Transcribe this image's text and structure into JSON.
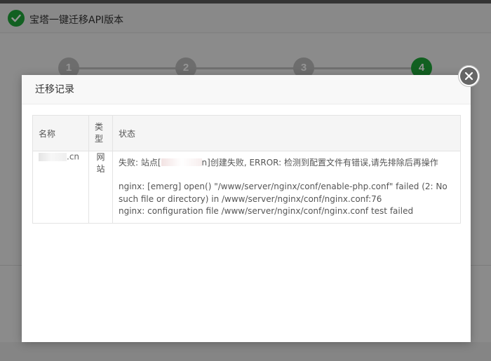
{
  "window": {
    "title": "宝塔一键迁移API版本",
    "steps": [
      "1",
      "2",
      "3",
      "4"
    ],
    "active_step": 4,
    "accent_color": "#20a53a"
  },
  "modal": {
    "title": "迁移记录",
    "close_icon": "close-icon",
    "table": {
      "headers": {
        "name": "名称",
        "type": "类型",
        "status": "状态"
      },
      "rows": [
        {
          "name_suffix": ".cn",
          "type": "网站",
          "status_prefix": "失败: 站点[",
          "status_site_suffix": "n",
          "status_middle": "]创建失败, ERROR: 检测到配置文件有错误,请先排除后再操作",
          "status_line2": "nginx: [emerg] open() \"/www/server/nginx/conf/enable-php.conf\" failed (2: No such file or directory) in /www/server/nginx/conf/nginx.conf:76",
          "status_line3": "nginx: configuration file /www/server/nginx/conf/nginx.conf test failed"
        }
      ]
    },
    "error_color": "#e03131"
  }
}
